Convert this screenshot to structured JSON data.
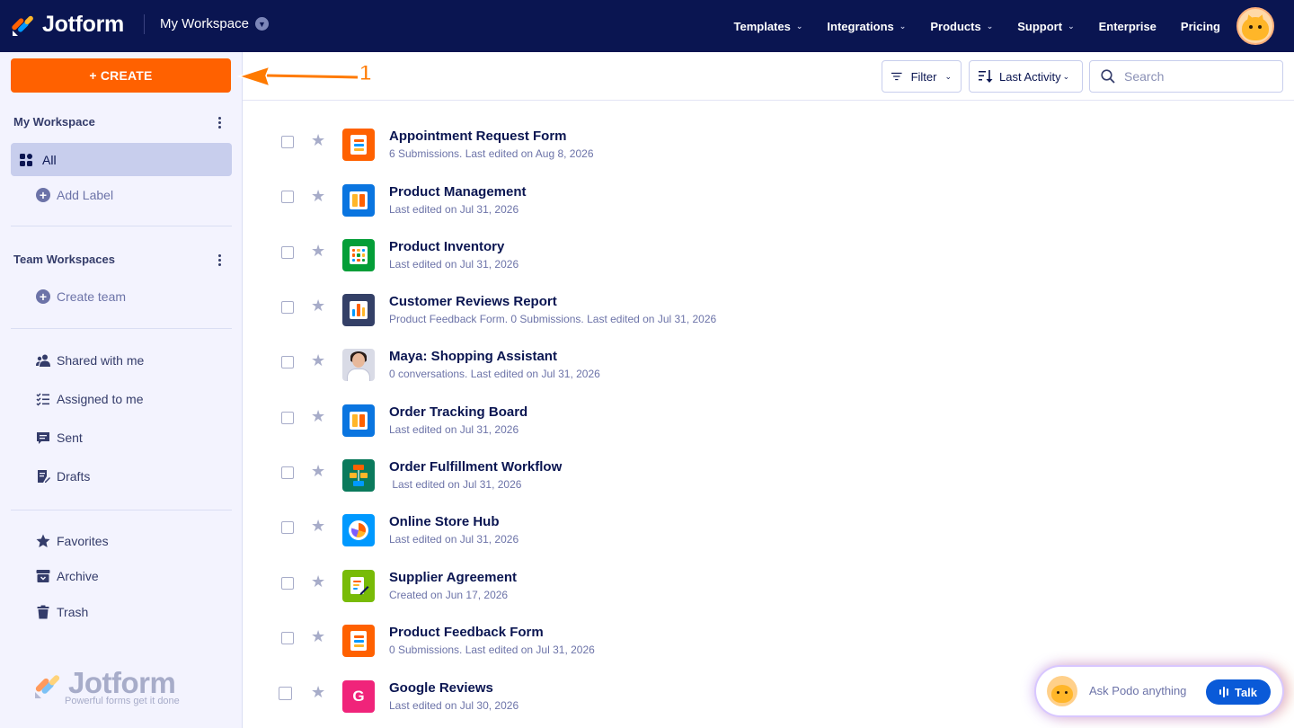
{
  "topbar": {
    "brand": "Jotform",
    "workspace": "My Workspace",
    "nav": [
      {
        "label": "Templates",
        "has_menu": true
      },
      {
        "label": "Integrations",
        "has_menu": true
      },
      {
        "label": "Products",
        "has_menu": true
      },
      {
        "label": "Support",
        "has_menu": true
      },
      {
        "label": "Enterprise",
        "has_menu": false
      },
      {
        "label": "Pricing",
        "has_menu": false
      }
    ],
    "avatar_icon": "podo-cat-avatar"
  },
  "sidebar": {
    "create_label": "+ CREATE",
    "my_workspace": {
      "heading": "My Workspace",
      "all_label": "All",
      "add_label": "Add Label"
    },
    "team_workspaces": {
      "heading": "Team Workspaces",
      "create_team": "Create team"
    },
    "shared": [
      {
        "label": "Shared with me",
        "icon": "users-icon"
      },
      {
        "label": "Assigned to me",
        "icon": "checklist-icon"
      },
      {
        "label": "Sent",
        "icon": "message-icon"
      },
      {
        "label": "Drafts",
        "icon": "draft-icon"
      }
    ],
    "bottom": [
      {
        "label": "Favorites",
        "icon": "star-icon"
      },
      {
        "label": "Archive",
        "icon": "archive-icon"
      },
      {
        "label": "Trash",
        "icon": "trash-icon"
      }
    ],
    "footer_brand": "Jotform",
    "footer_tagline": "Powerful forms get it done"
  },
  "toolbar": {
    "filter_label": "Filter",
    "sort_label": "Last Activity",
    "search_placeholder": "Search"
  },
  "annotation": {
    "number": "1",
    "color": "#ff7a00"
  },
  "items": [
    {
      "title": "Appointment Request Form",
      "subtitle": "6 Submissions. Last edited on Aug 8, 2026",
      "icon": "form-icon",
      "color": "#ff6100"
    },
    {
      "title": "Product Management",
      "subtitle": "Last edited on Jul 31, 2026",
      "icon": "board-icon",
      "color": "#0a75e0"
    },
    {
      "title": "Product Inventory",
      "subtitle": "Last edited on Jul 31, 2026",
      "icon": "table-icon",
      "color": "#049e38"
    },
    {
      "title": "Customer Reviews Report",
      "subtitle": "Product Feedback Form. 0 Submissions. Last edited on Jul 31, 2026",
      "icon": "report-icon",
      "color": "#344067"
    },
    {
      "title": "Maya: Shopping Assistant",
      "subtitle": "0 conversations. Last edited on Jul 31, 2026",
      "icon": "agent-avatar-icon",
      "color": "#d9dbe6"
    },
    {
      "title": "Order Tracking Board",
      "subtitle": "Last edited on Jul 31, 2026",
      "icon": "board-icon",
      "color": "#0a75e0"
    },
    {
      "title": "Order Fulfillment Workflow",
      "subtitle": " Last edited on Jul 31, 2026",
      "icon": "workflow-icon",
      "color": "#0b7a5c"
    },
    {
      "title": "Online Store Hub",
      "subtitle": "Last edited on Jul 31, 2026",
      "icon": "app-icon",
      "color": "#0099ff"
    },
    {
      "title": "Supplier Agreement",
      "subtitle": "Created on Jun 17, 2026",
      "icon": "sign-icon",
      "color": "#78bb07"
    },
    {
      "title": "Product Feedback Form",
      "subtitle": "0 Submissions. Last edited on Jul 31, 2026",
      "icon": "form-icon",
      "color": "#ff6100"
    },
    {
      "title": "Google Reviews",
      "subtitle": "Last edited on Jul 30, 2026",
      "icon": "google-g-icon",
      "color": "#f0247a",
      "letter": "G"
    }
  ],
  "podo": {
    "prompt": "Ask Podo anything",
    "talk_label": "Talk"
  }
}
